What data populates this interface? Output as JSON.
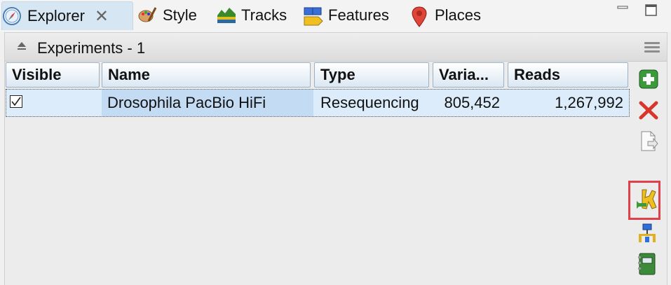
{
  "tabs": [
    {
      "label": "Explorer",
      "icon": "compass-icon",
      "active": true
    },
    {
      "label": "Style",
      "icon": "palette-icon",
      "active": false
    },
    {
      "label": "Tracks",
      "icon": "tracks-icon",
      "active": false
    },
    {
      "label": "Features",
      "icon": "features-icon",
      "active": false
    },
    {
      "label": "Places",
      "icon": "map-pin-icon",
      "active": false
    }
  ],
  "panel": {
    "title": "Experiments - 1"
  },
  "table": {
    "columns": [
      "Visible",
      "Name",
      "Type",
      "Varia...",
      "Reads"
    ],
    "rows": [
      {
        "visible": true,
        "name": "Drosophila PacBio HiFi",
        "type": "Resequencing",
        "variants": "805,452",
        "reads": "1,267,992"
      }
    ]
  },
  "toolbar": {
    "buttons": [
      "add-icon",
      "delete-icon",
      "import-icon",
      "tools-icon",
      "connect-icon",
      "notebook-icon"
    ],
    "highlighted": "tools-icon",
    "highlight_color": "#e0404a"
  }
}
